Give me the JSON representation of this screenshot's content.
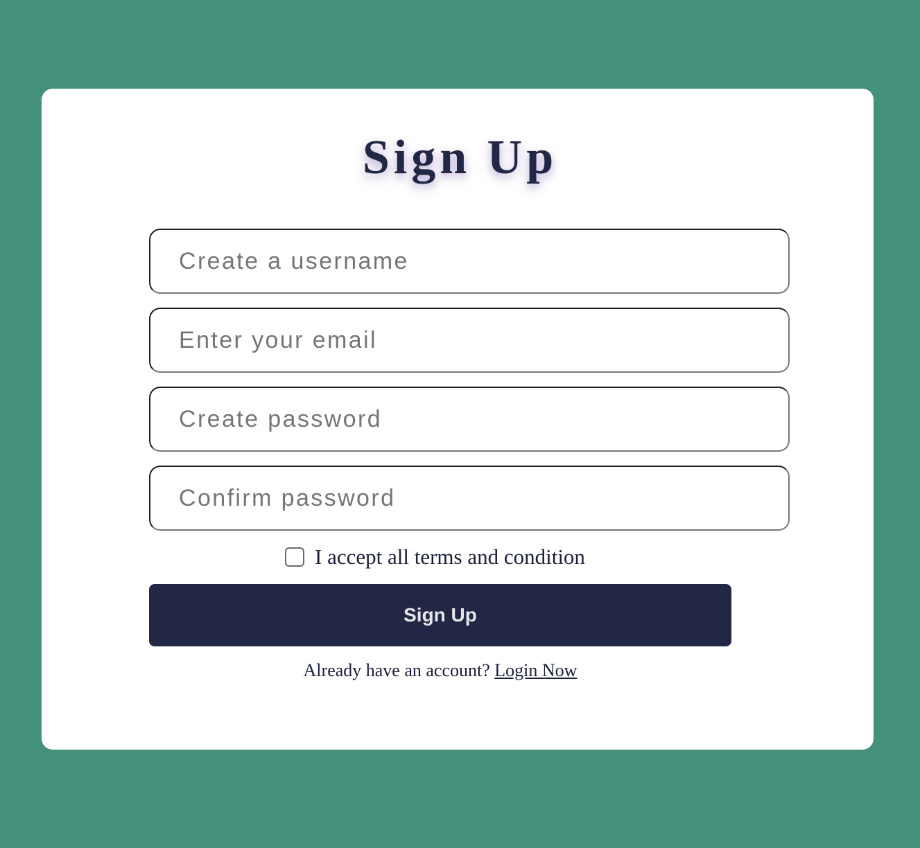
{
  "title": "Sign Up",
  "form": {
    "username_placeholder": "Create a username",
    "email_placeholder": "Enter your email",
    "password_placeholder": "Create password",
    "confirm_placeholder": "Confirm password",
    "terms_label": "I accept all terms and condition",
    "terms_checked": false,
    "submit_label": "Sign Up"
  },
  "footer": {
    "prompt": "Already have an account?",
    "login_label": "Login Now"
  },
  "colors": {
    "background": "#43917a",
    "primary": "#222745",
    "card": "#ffffff"
  }
}
